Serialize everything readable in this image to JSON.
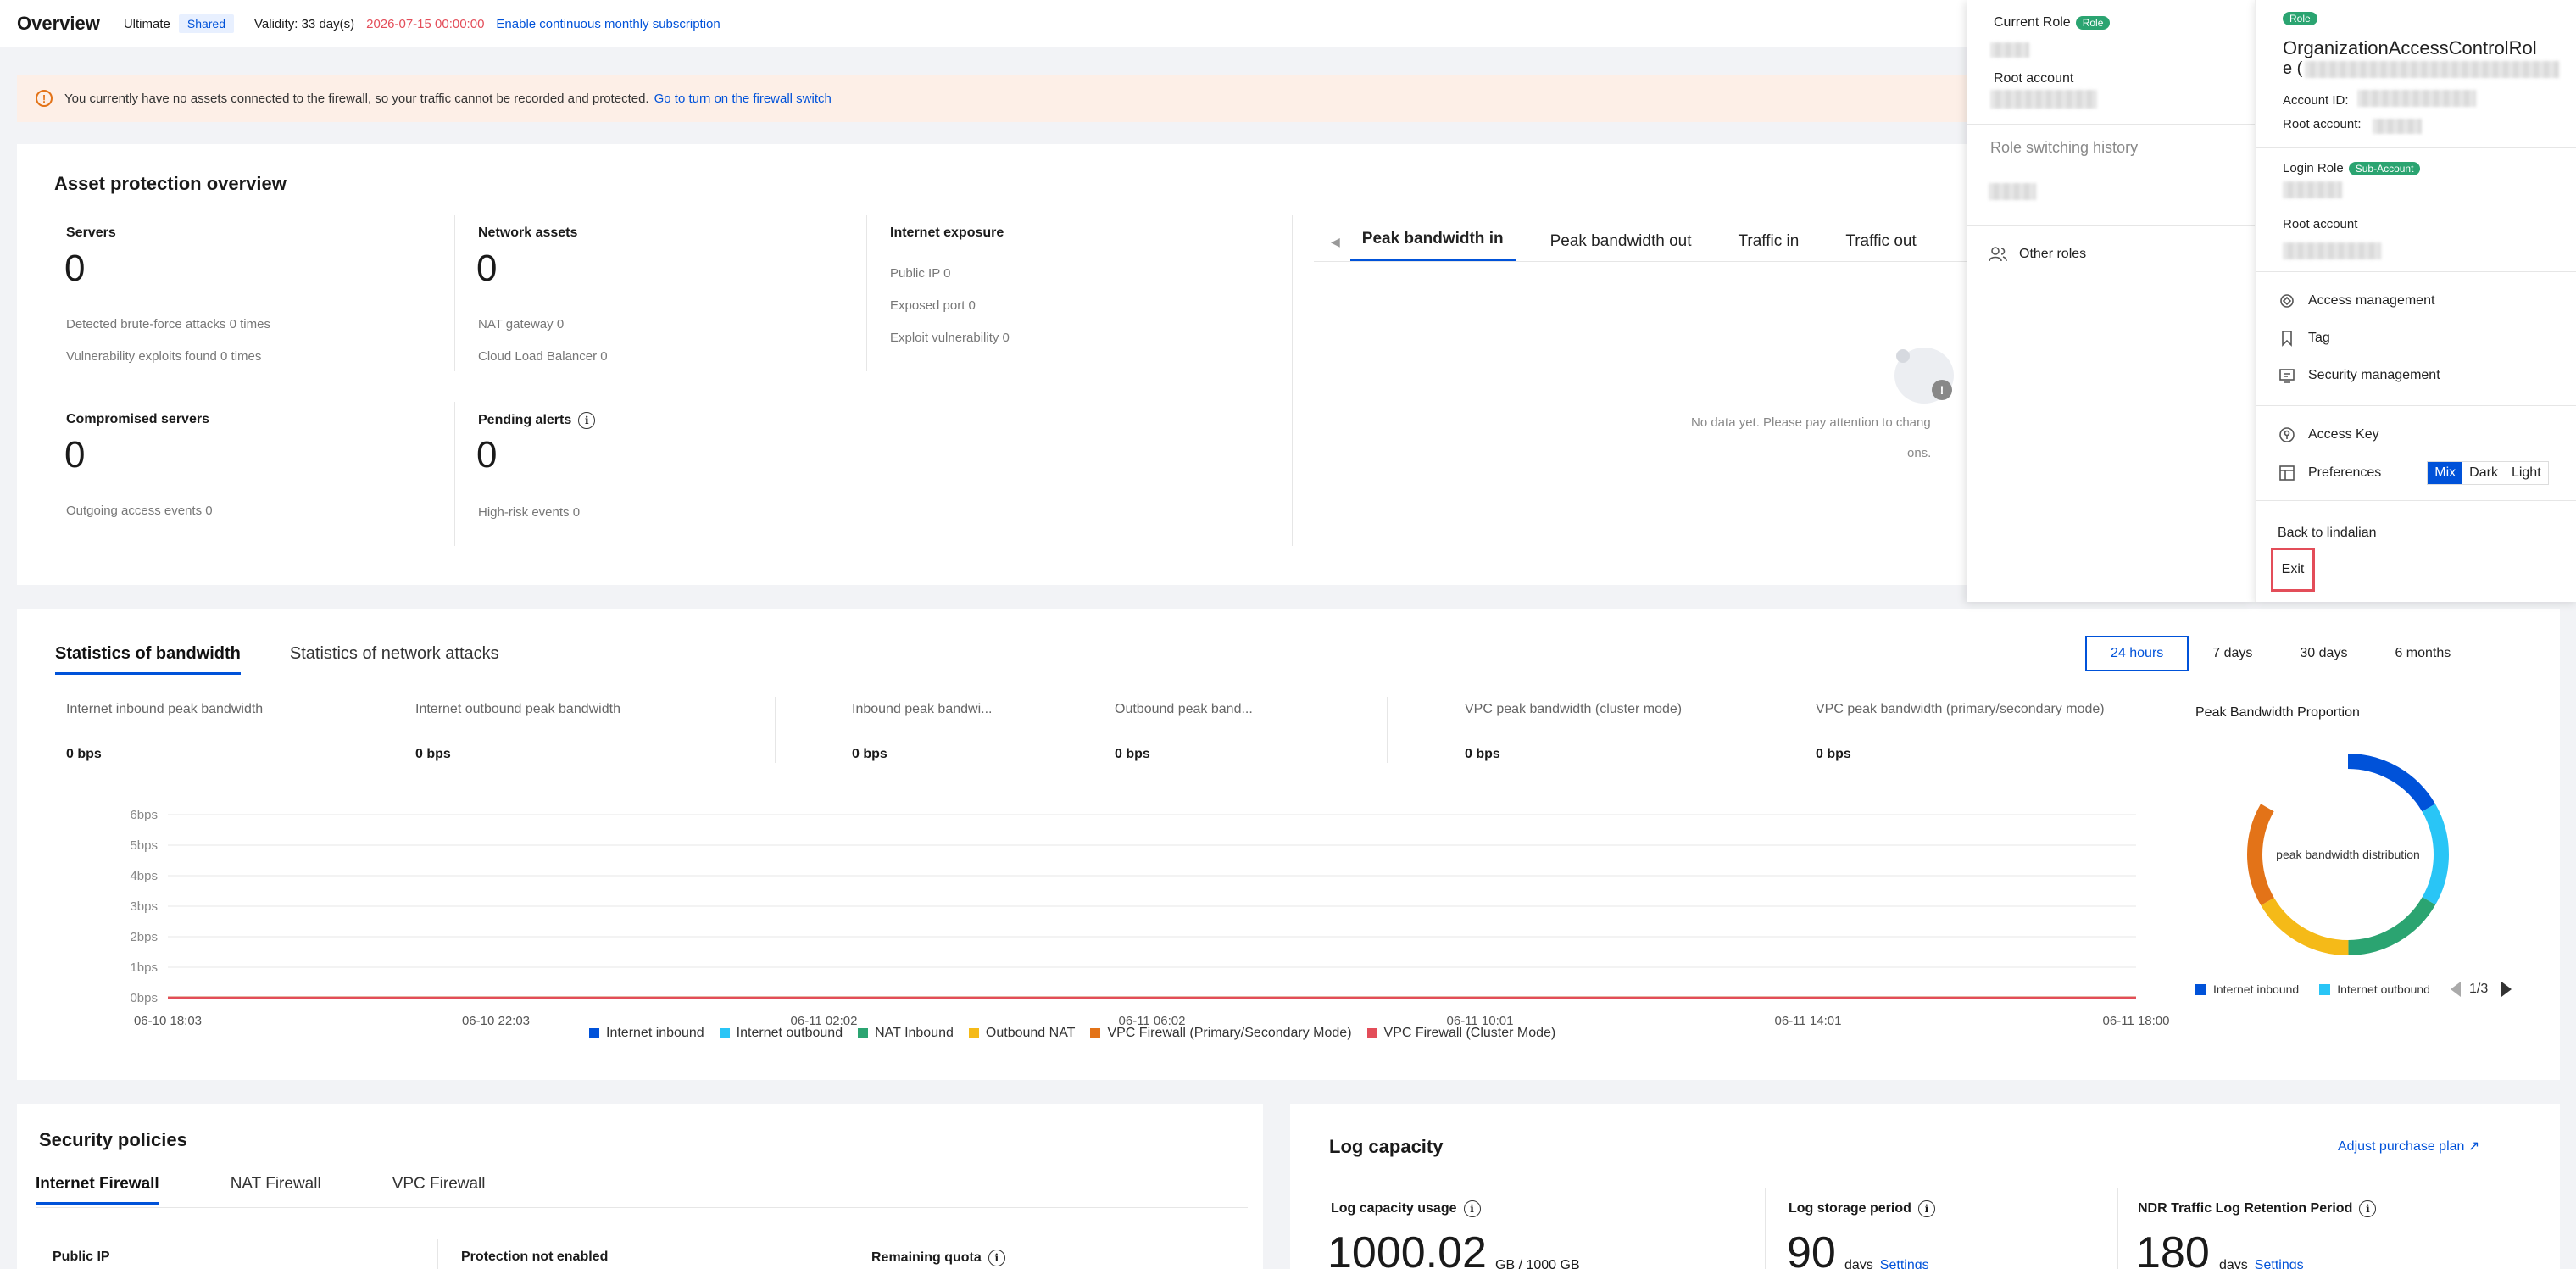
{
  "header": {
    "title": "Overview",
    "edition": "Ultimate",
    "shared": "Shared",
    "validity": "Validity: 33 day(s)",
    "expire": "2026-07-15 00:00:00",
    "subscription_link": "Enable continuous monthly subscription"
  },
  "alert": {
    "text": "You currently have no assets connected to the firewall, so your traffic cannot be recorded and protected.",
    "link": "Go to turn on the firewall switch"
  },
  "asset": {
    "title": "Asset protection overview",
    "servers": {
      "label": "Servers",
      "value": "0",
      "bruteforce": "Detected brute-force attacks  0    times",
      "vuln": "Vulnerability exploits found  0    times"
    },
    "network": {
      "label": "Network assets",
      "value": "0",
      "nat": "NAT gateway   0",
      "clb": "Cloud Load Balancer   0"
    },
    "exposure": {
      "label": "Internet exposure",
      "public_ip": "Public IP  0",
      "port": "Exposed port  0",
      "exploit": "Exploit vulnerability  0"
    },
    "compromised": {
      "label": "Compromised servers",
      "value": "0",
      "sub": "Outgoing access events  0"
    },
    "pending": {
      "label": "Pending alerts",
      "value": "0",
      "sub": "High-risk events  0"
    },
    "tabs": [
      "Peak bandwidth in",
      "Peak bandwidth out",
      "Traffic in",
      "Traffic out"
    ],
    "nodata_line1": "No data yet. Please pay attention to chang",
    "nodata_line2": "ons."
  },
  "bandwidth": {
    "tabs": [
      "Statistics of bandwidth",
      "Statistics of network attacks"
    ],
    "ranges": [
      "24 hours",
      "7 days",
      "30 days",
      "6 months"
    ],
    "metrics": [
      {
        "label": "Internet inbound peak bandwidth",
        "value": "0 bps"
      },
      {
        "label": "Internet outbound peak bandwidth",
        "value": "0 bps"
      },
      {
        "label": "Inbound peak bandwi...",
        "value": "0 bps"
      },
      {
        "label": "Outbound peak band...",
        "value": "0 bps"
      },
      {
        "label": "VPC peak bandwidth (cluster mode)",
        "value": "0 bps"
      },
      {
        "label": "VPC peak bandwidth (primary/secondary mode)",
        "value": "0 bps"
      }
    ],
    "proportion_title": "Peak Bandwidth Proportion",
    "donut_center": "peak bandwidth distribution",
    "donut_legend": [
      "Internet inbound",
      "Internet outbound"
    ],
    "pager": "1/3"
  },
  "chart_data": {
    "type": "line",
    "x": [
      "06-10 18:03",
      "06-10 22:03",
      "06-11 02:02",
      "06-11 06:02",
      "06-11 10:01",
      "06-11 14:01",
      "06-11 18:00"
    ],
    "y_ticks": [
      "6bps",
      "5bps",
      "4bps",
      "3bps",
      "2bps",
      "1bps",
      "0bps"
    ],
    "ylim": [
      0,
      6
    ],
    "series": [
      {
        "name": "Internet inbound",
        "color": "#0052d9",
        "values": [
          0,
          0,
          0,
          0,
          0,
          0,
          0
        ]
      },
      {
        "name": "Internet outbound",
        "color": "#29c5f6",
        "values": [
          0,
          0,
          0,
          0,
          0,
          0,
          0
        ]
      },
      {
        "name": "NAT Inbound",
        "color": "#2ba471",
        "values": [
          0,
          0,
          0,
          0,
          0,
          0,
          0
        ]
      },
      {
        "name": "Outbound NAT",
        "color": "#f5ba18",
        "values": [
          0,
          0,
          0,
          0,
          0,
          0,
          0
        ]
      },
      {
        "name": "VPC Firewall (Primary/Secondary Mode)",
        "color": "#e37318",
        "values": [
          0,
          0,
          0,
          0,
          0,
          0,
          0
        ]
      },
      {
        "name": "VPC Firewall (Cluster Mode)",
        "color": "#e34d59",
        "values": [
          0,
          0,
          0,
          0,
          0,
          0,
          0
        ]
      }
    ],
    "legend_position": "bottom",
    "grid": true
  },
  "security": {
    "title": "Security policies",
    "tabs": [
      "Internet Firewall",
      "NAT Firewall",
      "VPC Firewall"
    ],
    "cols": [
      "Public IP",
      "Protection not enabled",
      "Remaining quota"
    ]
  },
  "log": {
    "title": "Log capacity",
    "adjust": "Adjust purchase plan",
    "usage_label": "Log capacity usage",
    "usage_value": "1000.02",
    "usage_unit": "GB  /  1000   GB",
    "storage_label": "Log storage period",
    "storage_value": "90",
    "ndr_label": "NDR Traffic Log Retention Period",
    "ndr_value": "180",
    "days": "days",
    "settings": "Settings"
  },
  "role_panel": {
    "current_role": "Current Role",
    "role_badge": "Role",
    "root_account": "Root account",
    "history": "Role switching history",
    "other_roles": "Other roles"
  },
  "account_panel": {
    "badge": "Role",
    "name_line1": "OrganizationAccessControlRol",
    "name_line2": "e  (",
    "account_id": "Account ID:",
    "root_account_label": "Root account:",
    "login_role": "Login Role",
    "sub_badge": "Sub-Account",
    "root_account": "Root account",
    "menu": [
      "Access management",
      "Tag",
      "Security management",
      "Access Key",
      "Preferences"
    ],
    "theme": [
      "Mix",
      "Dark",
      "Light"
    ],
    "back": "Back to lindalian",
    "exit": "Exit"
  }
}
